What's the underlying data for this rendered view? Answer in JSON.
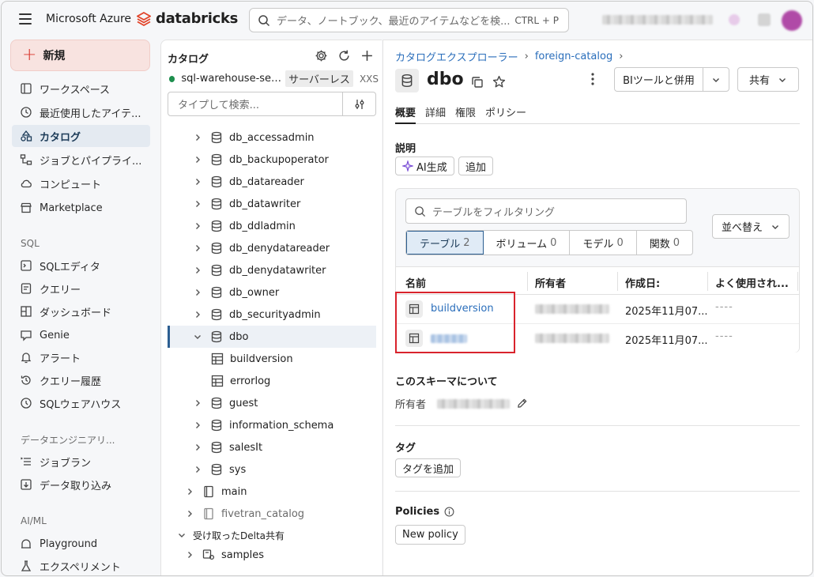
{
  "topbar": {
    "brand_ms": "Microsoft Azure",
    "brand_db": "databricks",
    "search_placeholder": "データ、ノートブック、最近のアイテムなどを検...",
    "search_shortcut": "CTRL + P"
  },
  "sidebar": {
    "new_label": "新規",
    "items": [
      {
        "label": "ワークスペース",
        "icon": "workspace-icon"
      },
      {
        "label": "最近使用したアイテ...",
        "icon": "clock-icon"
      },
      {
        "label": "カタログ",
        "icon": "catalog-icon",
        "active": true
      },
      {
        "label": "ジョブとパイプライ...",
        "icon": "workflow-icon"
      },
      {
        "label": "コンピュート",
        "icon": "cloud-icon"
      },
      {
        "label": "Marketplace",
        "icon": "store-icon"
      }
    ],
    "sql_section": "SQL",
    "sql_items": [
      {
        "label": "SQLエディタ",
        "icon": "editor-icon"
      },
      {
        "label": "クエリー",
        "icon": "query-icon"
      },
      {
        "label": "ダッシュボード",
        "icon": "dashboard-icon"
      },
      {
        "label": "Genie",
        "icon": "genie-icon"
      },
      {
        "label": "アラート",
        "icon": "bell-icon"
      },
      {
        "label": "クエリー履歴",
        "icon": "history-icon"
      },
      {
        "label": "SQLウェアハウス",
        "icon": "warehouse-icon"
      }
    ],
    "de_section": "データエンジニアリ...",
    "de_items": [
      {
        "label": "ジョブラン",
        "icon": "job-runs-icon"
      },
      {
        "label": "データ取り込み",
        "icon": "ingest-icon"
      }
    ],
    "ml_section": "AI/ML",
    "ml_items": [
      {
        "label": "Playground",
        "icon": "playground-icon"
      },
      {
        "label": "エクスペリメント",
        "icon": "flask-icon"
      }
    ]
  },
  "catalog": {
    "title": "カタログ",
    "warehouse_name": "sql-warehouse-serv...",
    "warehouse_type": "サーバーレス",
    "warehouse_size": "XXS",
    "search_placeholder": "タイプして検索...",
    "tree": [
      {
        "label": "db_accessadmin",
        "type": "schema",
        "level": 1
      },
      {
        "label": "db_backupoperator",
        "type": "schema",
        "level": 1
      },
      {
        "label": "db_datareader",
        "type": "schema",
        "level": 1
      },
      {
        "label": "db_datawriter",
        "type": "schema",
        "level": 1
      },
      {
        "label": "db_ddladmin",
        "type": "schema",
        "level": 1
      },
      {
        "label": "db_denydatareader",
        "type": "schema",
        "level": 1
      },
      {
        "label": "db_denydatawriter",
        "type": "schema",
        "level": 1
      },
      {
        "label": "db_owner",
        "type": "schema",
        "level": 1
      },
      {
        "label": "db_securityadmin",
        "type": "schema",
        "level": 1
      },
      {
        "label": "dbo",
        "type": "schema",
        "level": 1,
        "expanded": true,
        "selected": true
      },
      {
        "label": "buildversion",
        "type": "table",
        "level": 2
      },
      {
        "label": "errorlog",
        "type": "table",
        "level": 2
      },
      {
        "label": "guest",
        "type": "schema",
        "level": 1
      },
      {
        "label": "information_schema",
        "type": "schema",
        "level": 1
      },
      {
        "label": "salesIt",
        "type": "schema",
        "level": 1
      },
      {
        "label": "sys",
        "type": "schema",
        "level": 1
      },
      {
        "label": "main",
        "type": "catalog",
        "level": 0
      },
      {
        "label": "fivetran_catalog",
        "type": "catalog",
        "level": 0,
        "muted": true
      },
      {
        "label": "受け取ったDelta共有",
        "type": "group",
        "level": -1,
        "expanded": true
      },
      {
        "label": "samples",
        "type": "share",
        "level": 0
      }
    ]
  },
  "detail": {
    "breadcrumb": [
      "カタログエクスプローラー",
      "foreign-catalog"
    ],
    "title": "dbo",
    "bi_button": "BIツールと併用",
    "share_button": "共有",
    "tabs": [
      "概要",
      "詳細",
      "権限",
      "ポリシー"
    ],
    "description_label": "説明",
    "ai_button": "AI生成",
    "add_button": "追加",
    "filter_placeholder": "テーブルをフィルタリング",
    "sort_button": "並べ替え",
    "segments": [
      {
        "label": "テーブル",
        "count": "2"
      },
      {
        "label": "ボリューム",
        "count": "0"
      },
      {
        "label": "モデル",
        "count": "0"
      },
      {
        "label": "関数",
        "count": "0"
      }
    ],
    "columns": [
      "名前",
      "所有者",
      "作成日:",
      "よく使用され..."
    ],
    "rows": [
      {
        "name": "buildversion",
        "date": "2025年11月07...",
        "usage": "----"
      },
      {
        "name": "",
        "date": "2025年11月07...",
        "usage": "----"
      }
    ],
    "about_label": "このスキーマについて",
    "owner_label": "所有者",
    "tags_label": "タグ",
    "add_tag_button": "タグを追加",
    "policies_label": "Policies",
    "new_policy_button": "New policy"
  }
}
